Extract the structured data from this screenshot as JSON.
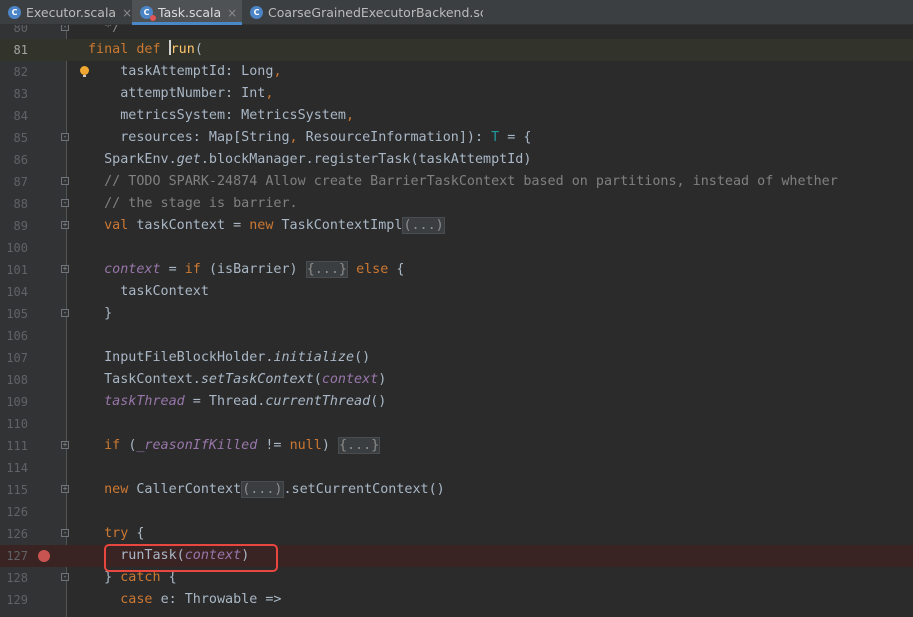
{
  "tabs": [
    {
      "label": "Executor.scala",
      "icon": "scala-file-icon",
      "close": "×",
      "active": false
    },
    {
      "label": "Task.scala",
      "icon": "scala-file-icon",
      "close": "×",
      "active": true
    },
    {
      "label": "CoarseGrainedExecutorBackend.scala",
      "icon": "scala-file-icon",
      "close": "",
      "active": false
    }
  ],
  "colors": {
    "keyword": "#cc7832",
    "function": "#ffc66d",
    "comment": "#808080",
    "variable": "#9876aa",
    "type_param": "#20999d",
    "breakpoint": "#c75450",
    "highlight_box": "#e8473f"
  },
  "lines": [
    {
      "num": "80",
      "code": [
        {
          "t": "  */",
          "c": "cm"
        }
      ]
    },
    {
      "num": "81",
      "code": [
        {
          "t": "final def ",
          "c": "kw"
        },
        {
          "t": "run",
          "c": "fn"
        },
        {
          "t": "("
        }
      ]
    },
    {
      "num": "82",
      "code": [
        {
          "t": "    taskAttemptId: Long",
          "c": ""
        },
        {
          "t": ",",
          "c": "kw"
        }
      ]
    },
    {
      "num": "83",
      "code": [
        {
          "t": "    attemptNumber: Int",
          "c": ""
        },
        {
          "t": ",",
          "c": "kw"
        }
      ]
    },
    {
      "num": "84",
      "code": [
        {
          "t": "    metricsSystem: MetricsSystem",
          "c": ""
        },
        {
          "t": ",",
          "c": "kw"
        }
      ]
    },
    {
      "num": "85",
      "code": [
        {
          "t": "    resources: Map[String",
          "c": ""
        },
        {
          "t": ", ",
          "c": "kw"
        },
        {
          "t": "ResourceInformation]): "
        },
        {
          "t": "T",
          "c": "tp"
        },
        {
          "t": " = {"
        }
      ]
    },
    {
      "num": "86",
      "code": [
        {
          "t": "  SparkEnv."
        },
        {
          "t": "get",
          "c": "it"
        },
        {
          "t": ".blockManager.registerTask(taskAttemptId)"
        }
      ]
    },
    {
      "num": "87",
      "code": [
        {
          "t": "  // TODO SPARK-24874 Allow create BarrierTaskContext based on partitions, instead of whether",
          "c": "cm"
        }
      ]
    },
    {
      "num": "88",
      "code": [
        {
          "t": "  // the stage is barrier.",
          "c": "cm"
        }
      ]
    },
    {
      "num": "89",
      "code": [
        {
          "t": "  "
        },
        {
          "t": "val ",
          "c": "kw"
        },
        {
          "t": "taskContext = "
        },
        {
          "t": "new ",
          "c": "kw"
        },
        {
          "t": "TaskContextImpl"
        },
        {
          "t": "(...)",
          "c": "fd"
        }
      ]
    },
    {
      "num": "100",
      "code": []
    },
    {
      "num": "101",
      "code": [
        {
          "t": "  "
        },
        {
          "t": "context",
          "c": "vr it"
        },
        {
          "t": " = "
        },
        {
          "t": "if ",
          "c": "kw"
        },
        {
          "t": "(isBarrier) "
        },
        {
          "t": "{...}",
          "c": "fd"
        },
        {
          "t": " "
        },
        {
          "t": "else ",
          "c": "kw"
        },
        {
          "t": "{"
        }
      ]
    },
    {
      "num": "104",
      "code": [
        {
          "t": "    taskContext"
        }
      ]
    },
    {
      "num": "105",
      "code": [
        {
          "t": "  }"
        }
      ]
    },
    {
      "num": "106",
      "code": []
    },
    {
      "num": "107",
      "code": [
        {
          "t": "  InputFileBlockHolder."
        },
        {
          "t": "initialize",
          "c": "it"
        },
        {
          "t": "()"
        }
      ]
    },
    {
      "num": "108",
      "code": [
        {
          "t": "  TaskContext."
        },
        {
          "t": "setTaskContext",
          "c": "it"
        },
        {
          "t": "("
        },
        {
          "t": "context",
          "c": "vr it"
        },
        {
          "t": ")"
        }
      ]
    },
    {
      "num": "109",
      "code": [
        {
          "t": "  "
        },
        {
          "t": "taskThread",
          "c": "vr it"
        },
        {
          "t": " = Thread."
        },
        {
          "t": "currentThread",
          "c": "it"
        },
        {
          "t": "()"
        }
      ]
    },
    {
      "num": "110",
      "code": []
    },
    {
      "num": "111",
      "code": [
        {
          "t": "  "
        },
        {
          "t": "if ",
          "c": "kw"
        },
        {
          "t": "("
        },
        {
          "t": "_reasonIfKilled",
          "c": "vr it"
        },
        {
          "t": " != "
        },
        {
          "t": "null",
          "c": "kw"
        },
        {
          "t": ") "
        },
        {
          "t": "{...}",
          "c": "fd"
        }
      ]
    },
    {
      "num": "114",
      "code": []
    },
    {
      "num": "115",
      "code": [
        {
          "t": "  "
        },
        {
          "t": "new ",
          "c": "kw"
        },
        {
          "t": "CallerContext"
        },
        {
          "t": "(...)",
          "c": "fd"
        },
        {
          "t": ".setCurrentContext()"
        }
      ]
    },
    {
      "num": "126",
      "code": []
    },
    {
      "num": "126",
      "code": [
        {
          "t": "  "
        },
        {
          "t": "try ",
          "c": "kw"
        },
        {
          "t": "{"
        }
      ]
    },
    {
      "num": "127",
      "code": [
        {
          "t": "    runTask("
        },
        {
          "t": "context",
          "c": "vr it"
        },
        {
          "t": ")"
        }
      ]
    },
    {
      "num": "128",
      "code": [
        {
          "t": "  } "
        },
        {
          "t": "catch ",
          "c": "kw"
        },
        {
          "t": "{"
        }
      ]
    },
    {
      "num": "129",
      "code": [
        {
          "t": "    "
        },
        {
          "t": "case ",
          "c": "kw"
        },
        {
          "t": "e: Throwable =>"
        }
      ]
    }
  ]
}
